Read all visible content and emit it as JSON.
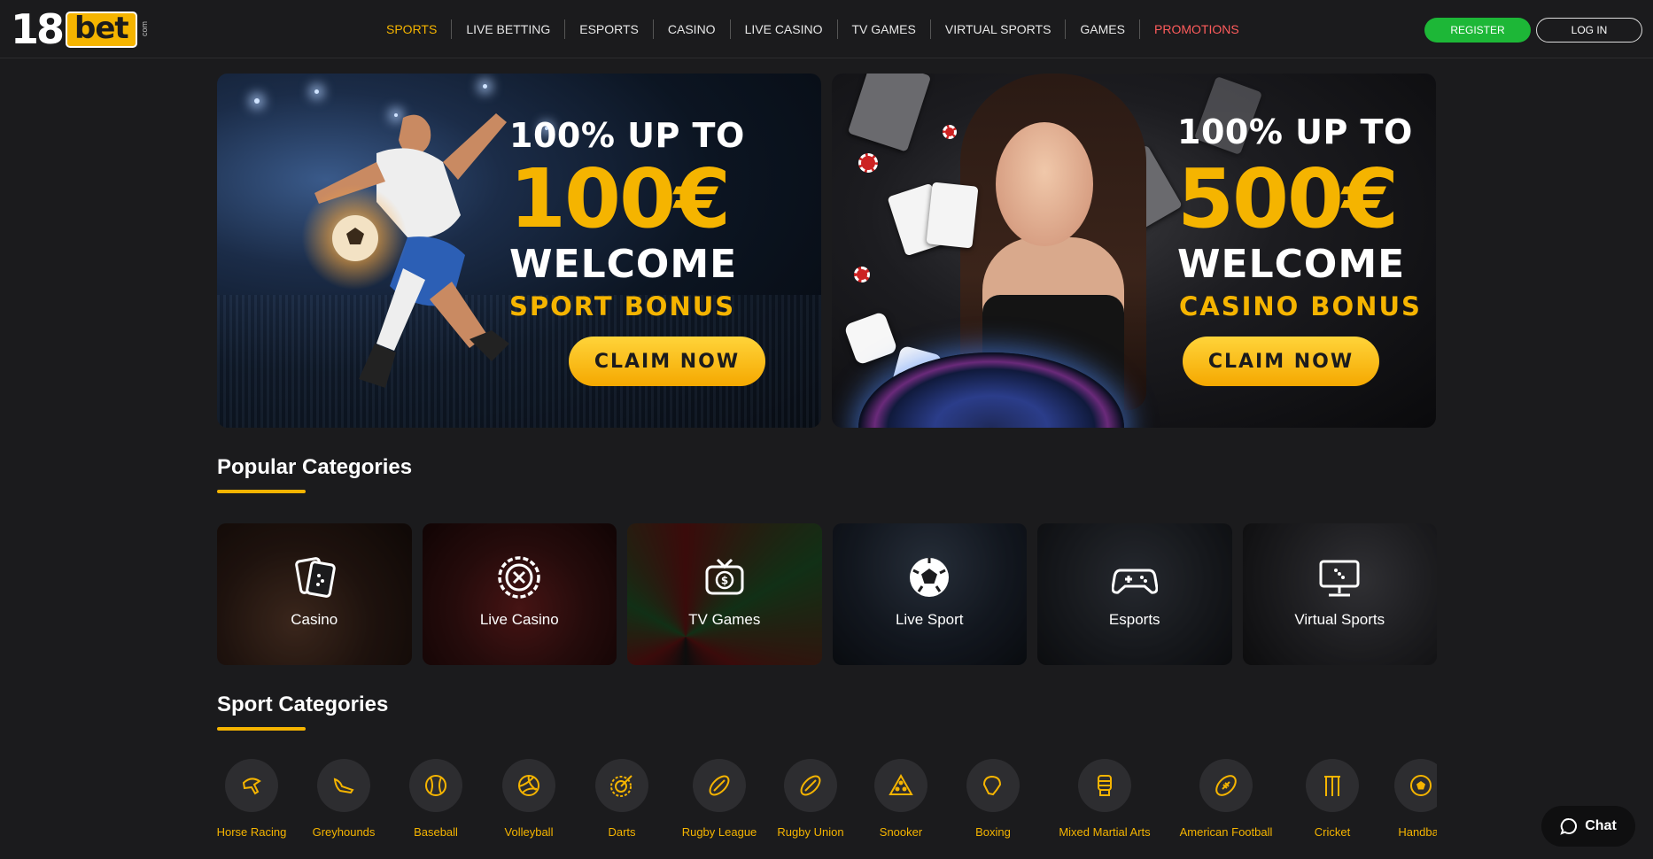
{
  "logo": {
    "number": "18",
    "word": "bet",
    "suffix": "com"
  },
  "nav": {
    "items": [
      {
        "label": "SPORTS"
      },
      {
        "label": "LIVE BETTING"
      },
      {
        "label": "ESPORTS"
      },
      {
        "label": "CASINO"
      },
      {
        "label": "LIVE CASINO"
      },
      {
        "label": "TV GAMES"
      },
      {
        "label": "VIRTUAL SPORTS"
      },
      {
        "label": "GAMES"
      },
      {
        "label": "PROMOTIONS"
      }
    ],
    "active": "SPORTS"
  },
  "auth": {
    "register": "REGISTER",
    "login": "LOG IN"
  },
  "banners": [
    {
      "headline": "100% UP TO",
      "amount": "100€",
      "welcome": "WELCOME",
      "bonus": "SPORT BONUS",
      "cta": "CLAIM NOW"
    },
    {
      "headline": "100% UP TO",
      "amount": "500€",
      "welcome": "WELCOME",
      "bonus": "CASINO BONUS",
      "cta": "CLAIM NOW"
    }
  ],
  "popular": {
    "title": "Popular Categories",
    "items": [
      {
        "label": "Casino",
        "icon": "cards-icon"
      },
      {
        "label": "Live Casino",
        "icon": "roulette-chip-icon"
      },
      {
        "label": "TV Games",
        "icon": "tv-dollar-icon"
      },
      {
        "label": "Live Sport",
        "icon": "soccer-ball-icon"
      },
      {
        "label": "Esports",
        "icon": "gamepad-icon"
      },
      {
        "label": "Virtual Sports",
        "icon": "monitor-dice-icon"
      }
    ]
  },
  "sport_categories": {
    "title": "Sport Categories",
    "items": [
      {
        "label": "Horse Racing",
        "icon": "horse-icon"
      },
      {
        "label": "Greyhounds",
        "icon": "greyhound-icon"
      },
      {
        "label": "Baseball",
        "icon": "baseball-icon"
      },
      {
        "label": "Volleyball",
        "icon": "volleyball-icon"
      },
      {
        "label": "Darts",
        "icon": "dartboard-icon"
      },
      {
        "label": "Rugby League",
        "icon": "rugby-ball-icon"
      },
      {
        "label": "Rugby Union",
        "icon": "rugby-ball-icon"
      },
      {
        "label": "Snooker",
        "icon": "snooker-balls-icon"
      },
      {
        "label": "Boxing",
        "icon": "boxing-glove-icon"
      },
      {
        "label": "Mixed Martial Arts",
        "icon": "mma-glove-icon"
      },
      {
        "label": "American Football",
        "icon": "american-football-icon"
      },
      {
        "label": "Cricket",
        "icon": "cricket-wicket-icon"
      },
      {
        "label": "Handball",
        "icon": "handball-icon"
      }
    ]
  },
  "chat": {
    "label": "Chat"
  },
  "colors": {
    "accent": "#f5b400",
    "register": "#1db737",
    "promo": "#ff5c5c",
    "background": "#1b1b1d"
  }
}
